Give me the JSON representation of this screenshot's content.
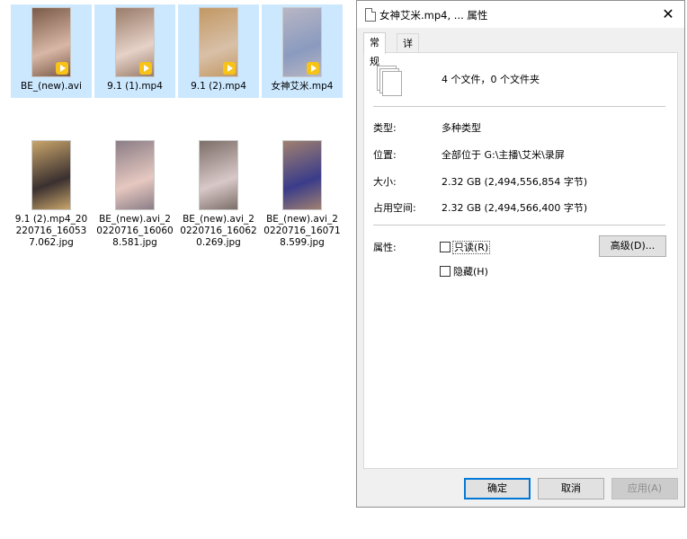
{
  "explorer": {
    "files": [
      {
        "name": "BE_(new).avi",
        "type": "video",
        "selected": true,
        "thumb": [
          "#7a5a48",
          "#d9b7a6"
        ]
      },
      {
        "name": "9.1 (1).mp4",
        "type": "video",
        "selected": true,
        "thumb": [
          "#9a7c6a",
          "#e6d2c8"
        ]
      },
      {
        "name": "9.1 (2).mp4",
        "type": "video",
        "selected": true,
        "thumb": [
          "#c29864",
          "#d8c0a8"
        ]
      },
      {
        "name": "女神艾米.mp4",
        "type": "video",
        "selected": true,
        "thumb": [
          "#b8b6c4",
          "#8a9abf"
        ]
      },
      {
        "name": "9.1 (2).mp4_20220716_160537.062.jpg",
        "type": "image",
        "selected": false,
        "thumb": [
          "#c9a56a",
          "#3a3030"
        ]
      },
      {
        "name": "BE_(new).avi_20220716_160608.581.jpg",
        "type": "image",
        "selected": false,
        "thumb": [
          "#8b7d86",
          "#e6c8c0"
        ]
      },
      {
        "name": "BE_(new).avi_20220716_160620.269.jpg",
        "type": "image",
        "selected": false,
        "thumb": [
          "#7c6e68",
          "#d8c8c8"
        ]
      },
      {
        "name": "BE_(new).avi_20220716_160718.599.jpg",
        "type": "image",
        "selected": false,
        "thumb": [
          "#a08070",
          "#3a3c8a"
        ]
      }
    ]
  },
  "dialog": {
    "title": "女神艾米.mp4, ... 属性",
    "close_icon": "close-icon",
    "tabs": [
      {
        "label": "常规",
        "active": true
      },
      {
        "label": "详细信息",
        "active": false
      }
    ],
    "summary": "4 个文件，0 个文件夹",
    "rows": [
      {
        "label": "类型:",
        "value": "多种类型"
      },
      {
        "label": "位置:",
        "value": "全部位于 G:\\主播\\艾米\\录屏"
      },
      {
        "label": "大小:",
        "value": "2.32 GB (2,494,556,854 字节)"
      },
      {
        "label": "占用空间:",
        "value": "2.32 GB (2,494,566,400 字节)"
      }
    ],
    "attributes_label": "属性:",
    "readonly_label": "只读(R)",
    "hidden_label": "隐藏(H)",
    "readonly_checked": false,
    "hidden_checked": false,
    "advanced_button": "高级(D)...",
    "ok_button": "确定",
    "cancel_button": "取消",
    "apply_button": "应用(A)",
    "colors": {
      "accent": "#0078d7",
      "selection": "#cce8ff"
    }
  }
}
